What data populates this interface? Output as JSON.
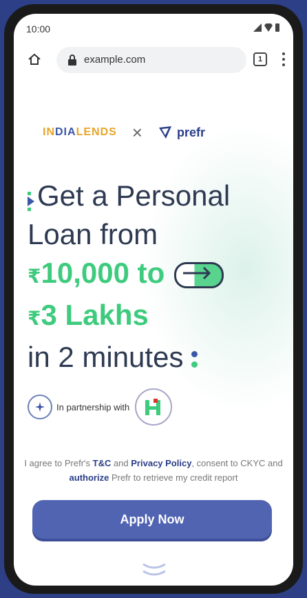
{
  "status_bar": {
    "time": "10:00"
  },
  "browser": {
    "url": "example.com",
    "tab_count": "1"
  },
  "brands": {
    "partner_a_prefix": "IN",
    "partner_a_middle": "DIA",
    "partner_a_rest": "LENDS",
    "separator": "×",
    "partner_b": "prefr"
  },
  "headline": {
    "line1": "Get a Personal",
    "line2": "Loan from",
    "amount1": "10,000 to",
    "amount2": "3 Lakhs",
    "rupee": "₹",
    "line5": "in 2 minutes"
  },
  "partnership": {
    "text": "In partnership with"
  },
  "consent": {
    "part1": "I agree to Prefr's ",
    "tnc": "T&C",
    "part2": " and ",
    "privacy": "Privacy Policy",
    "part3": ", consent to CKYC and ",
    "authorize": "authorize",
    "part4": " Prefr to retrieve my credit report"
  },
  "cta": {
    "apply_label": "Apply Now"
  },
  "colors": {
    "accent": "#5164b2",
    "green": "#3ecb7e",
    "brand_blue": "#2a3d88",
    "orange": "#e9a427"
  }
}
